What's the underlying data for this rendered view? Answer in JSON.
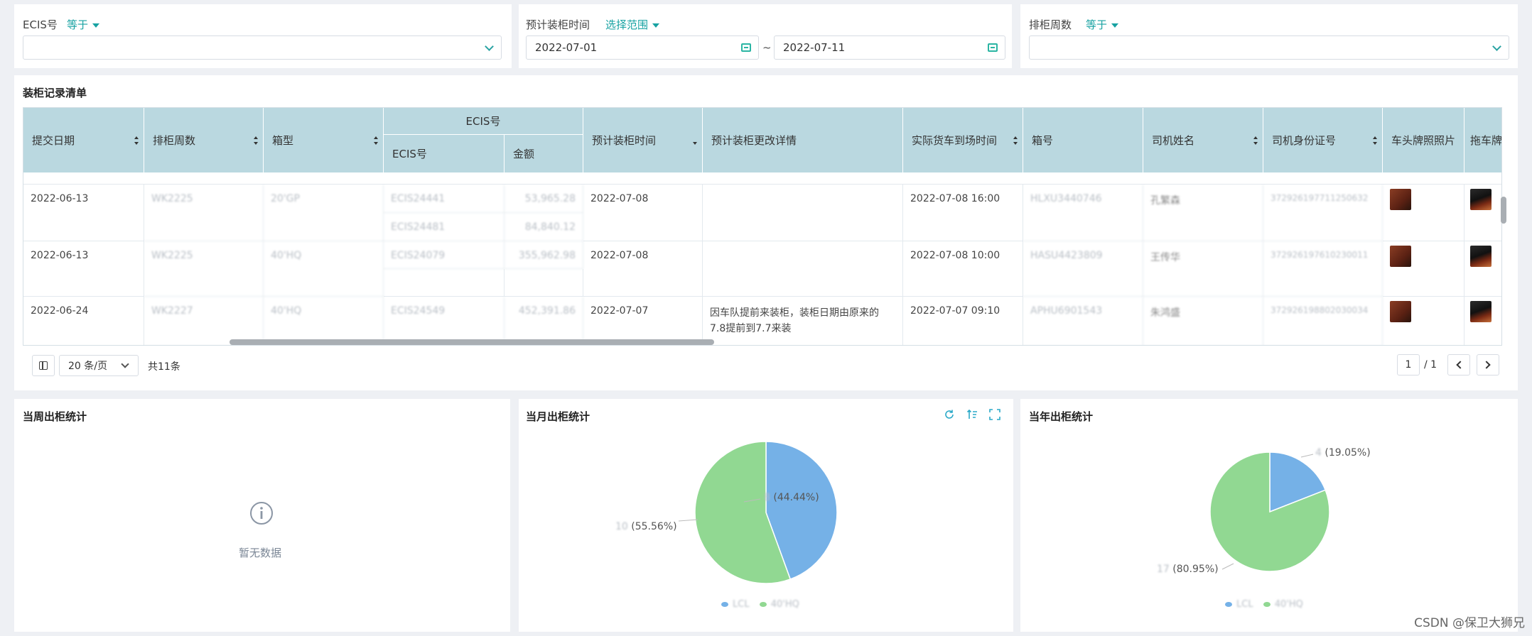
{
  "filters": {
    "ecis": {
      "label": "ECIS号",
      "operator": "等于",
      "value": ""
    },
    "load_time": {
      "label": "预计装柜时间",
      "operator": "选择范围",
      "start": "2022-07-01",
      "separator": "~",
      "end": "2022-07-11"
    },
    "week": {
      "label": "排柜周数",
      "operator": "等于",
      "value": ""
    }
  },
  "table_section": {
    "title": "装柜记录清单",
    "group_header": "ECIS号",
    "columns": [
      "提交日期",
      "排柜周数",
      "箱型",
      "ECIS号",
      "金额",
      "预计装柜时间",
      "预计装柜更改详情",
      "实际货车到场时间",
      "箱号",
      "司机姓名",
      "司机身份证号",
      "车头牌照照片",
      "拖车牌"
    ],
    "rows": [
      {
        "submit_date": "2022-06-13",
        "week": "WK2225",
        "box": "20'GP",
        "ecis": [
          "ECIS24441",
          "ECIS24481"
        ],
        "amount": [
          "53,965.28",
          "84,840.12"
        ],
        "plan_time": "2022-07-08",
        "change": "",
        "arrive": "2022-07-08 16:00",
        "box_no": "HLXU3440746",
        "driver": "孔繁森",
        "id_no": "372926197711250632"
      },
      {
        "submit_date": "2022-06-13",
        "week": "WK2225",
        "box": "40'HQ",
        "ecis": [
          "ECIS24079",
          ""
        ],
        "amount": [
          "355,962.98",
          ""
        ],
        "plan_time": "2022-07-08",
        "change": "",
        "arrive": "2022-07-08 10:00",
        "box_no": "HASU4423809",
        "driver": "王传华",
        "id_no": "372926197610230011"
      },
      {
        "submit_date": "2022-06-24",
        "week": "WK2227",
        "box": "40'HQ",
        "ecis": [
          "ECIS24549"
        ],
        "amount": [
          "452,391.86"
        ],
        "plan_time": "2022-07-07",
        "change_line1": "因车队提前来装柜，装柜日期由原来的",
        "change_line2": "7.8提前到7.7来装",
        "arrive": "2022-07-07 09:10",
        "box_no": "APHU6901543",
        "driver": "朱鸿盛",
        "id_no": "372926198802030034"
      }
    ],
    "pagination": {
      "page_size": "20 条/页",
      "total": "共11条",
      "current": "1",
      "pages": "/ 1"
    }
  },
  "week_stats": {
    "title": "当周出柜统计",
    "empty_text": "暂无数据",
    "icon": "info-circle-icon"
  },
  "month_stats": {
    "title": "当月出柜统计",
    "label_blue": "(44.44%)",
    "label_green": "(55.56%)",
    "legend": [
      "LCL",
      "40'HQ"
    ]
  },
  "year_stats": {
    "title": "当年出柜统计",
    "label_blue": "(19.05%)",
    "label_green": "(80.95%)",
    "legend": [
      "LCL",
      "40'HQ"
    ]
  },
  "watermark": "CSDN @保卫大狮兄",
  "chart_data": [
    {
      "type": "pie",
      "title": "当月出柜统计",
      "categories": [
        "LCL",
        "40'HQ"
      ],
      "values": [
        44.44,
        55.56
      ],
      "colors": [
        "#75b1e7",
        "#91d892"
      ]
    },
    {
      "type": "pie",
      "title": "当年出柜统计",
      "categories": [
        "LCL",
        "40'HQ"
      ],
      "values": [
        19.05,
        80.95
      ],
      "colors": [
        "#75b1e7",
        "#91d892"
      ]
    }
  ],
  "colors": {
    "accent": "#17a2a2",
    "header": "#bad8e0",
    "pie_blue": "#75b1e7",
    "pie_green": "#91d892"
  }
}
